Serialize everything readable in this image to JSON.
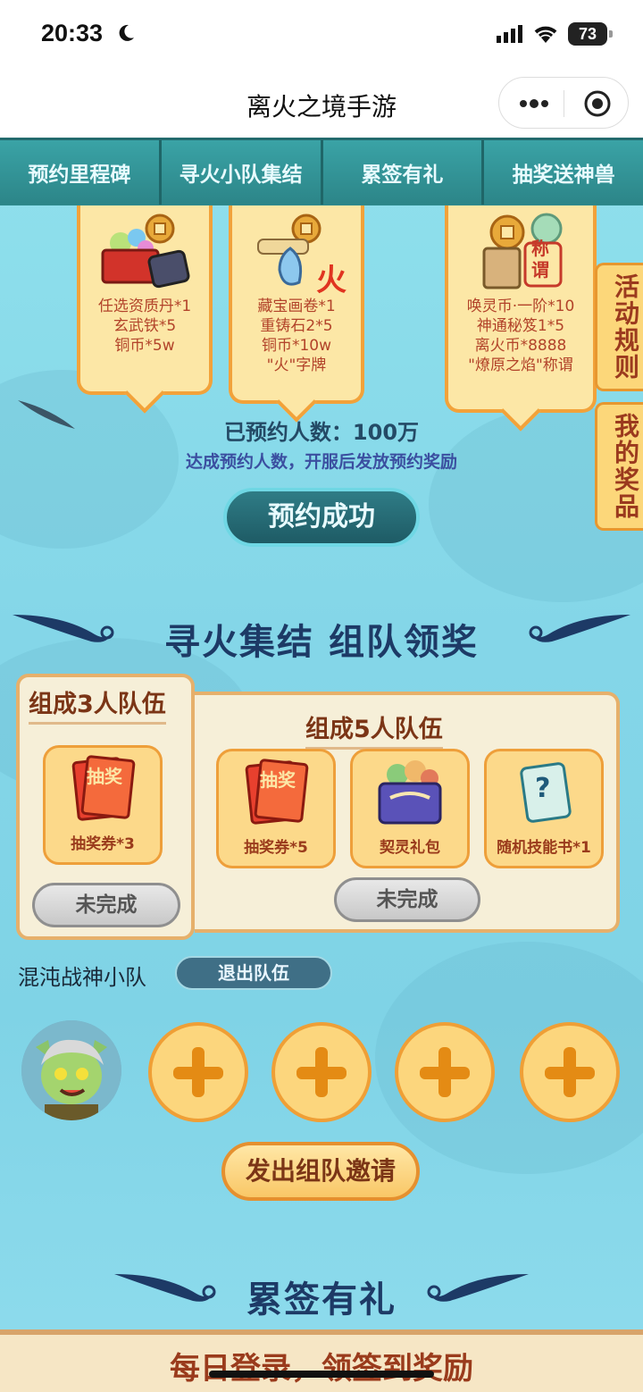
{
  "status_bar": {
    "time": "20:33",
    "battery": "73"
  },
  "title_bar": {
    "title": "离火之境手游"
  },
  "tabs": [
    {
      "label": "预约里程碑"
    },
    {
      "label": "寻火小队集结"
    },
    {
      "label": "累签有礼"
    },
    {
      "label": "抽奖送神兽"
    }
  ],
  "reward_cards": [
    {
      "lines": [
        "任选资质丹*1",
        "玄武铁*5",
        "铜币*5w"
      ]
    },
    {
      "lines": [
        "藏宝画卷*1",
        "重铸石2*5",
        "铜币*10w",
        "\"火\"字牌"
      ],
      "badge": "火"
    },
    {
      "lines": [
        "唤灵币·一阶*10",
        "神通秘笈1*5",
        "离火币*8888",
        "\"燎原之焰\"称谓"
      ],
      "badge": "称谓"
    }
  ],
  "side_tags": {
    "rules": "活动规则",
    "prizes": "我的奖品"
  },
  "reservation": {
    "count_text": "已预约人数：100万",
    "note": "达成预约人数，开服后发放预约奖励",
    "button": "预约成功"
  },
  "team_section": {
    "title": "寻火集结  组队领奖",
    "team3": {
      "title": "组成3人队伍",
      "prize": {
        "label": "抽奖券*3",
        "img_text": "抽奖"
      },
      "status": "未完成"
    },
    "team5": {
      "title": "组成5人队伍",
      "prizes": [
        {
          "label": "抽奖券*5",
          "img_text": "抽奖"
        },
        {
          "label": "契灵礼包"
        },
        {
          "label": "随机技能书*1",
          "img_text": "?"
        }
      ],
      "status": "未完成"
    },
    "team_name": "混沌战神小队",
    "leave_button": "退出队伍",
    "invite_button": "发出组队邀请"
  },
  "sign_section": {
    "title": "累签有礼",
    "banner": "每日登录，领签到奖励"
  },
  "colors": {
    "tab_bg": "#2f8b8e",
    "page_bg": "#8fe0ec",
    "accent_orange": "#f2a23a",
    "title_navy": "#1d3a66"
  }
}
